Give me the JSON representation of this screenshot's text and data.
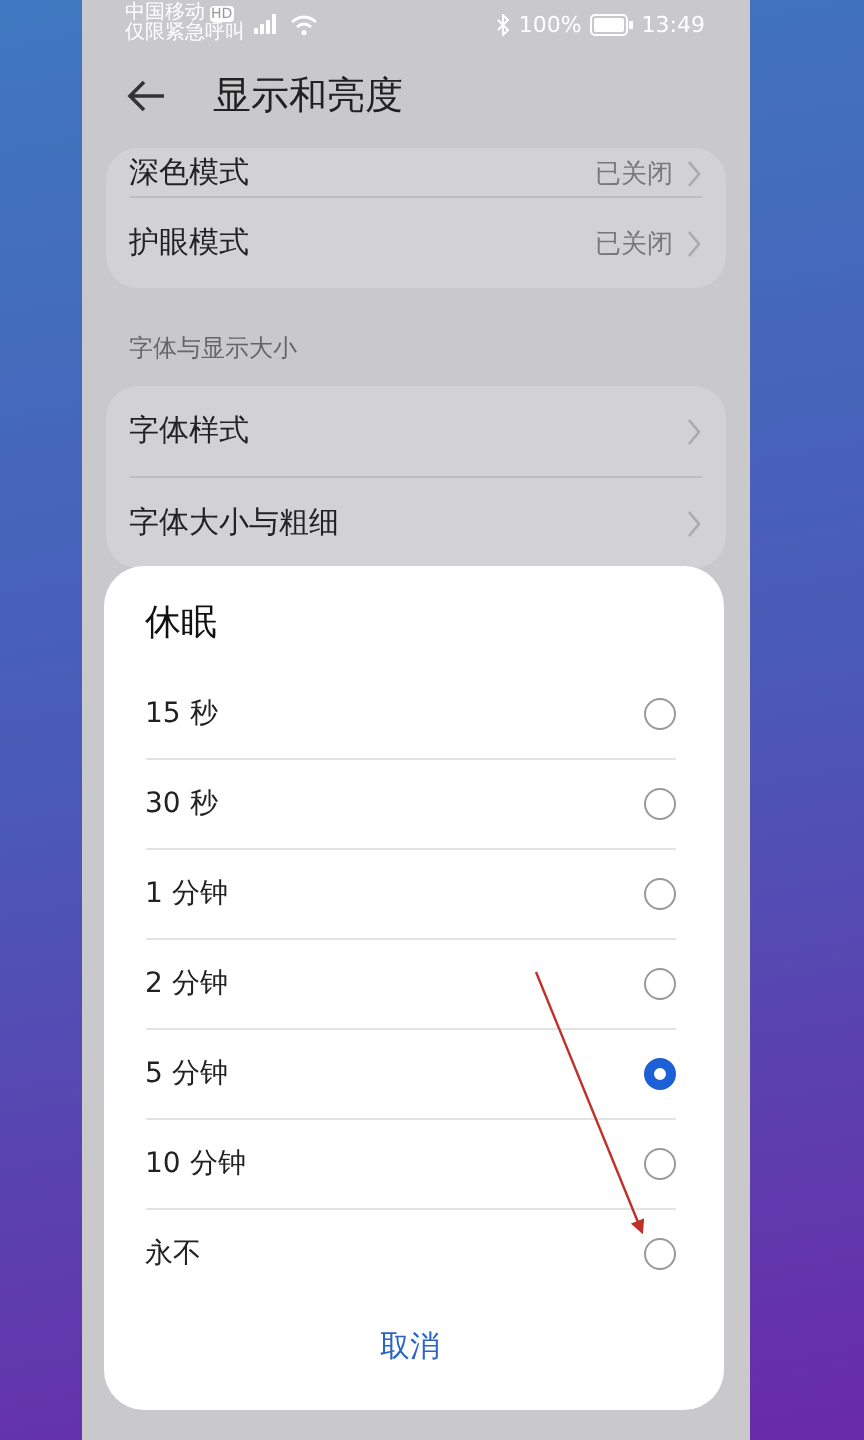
{
  "status_bar": {
    "carrier": "中国移动",
    "carrier_badge": "HD",
    "network_note": "仅限紧急呼叫",
    "battery": "100%",
    "time": "13:49"
  },
  "header": {
    "title": "显示和亮度"
  },
  "groups": [
    {
      "items": [
        {
          "label": "深色模式",
          "value": "已关闭"
        },
        {
          "label": "护眼模式",
          "value": "已关闭"
        }
      ]
    },
    {
      "heading": "字体与显示大小",
      "items": [
        {
          "label": "字体样式"
        },
        {
          "label": "字体大小与粗细"
        }
      ]
    }
  ],
  "dialog": {
    "title": "休眠",
    "options": [
      {
        "label": "15 秒",
        "selected": false
      },
      {
        "label": "30 秒",
        "selected": false
      },
      {
        "label": "1 分钟",
        "selected": false
      },
      {
        "label": "2 分钟",
        "selected": false
      },
      {
        "label": "5 分钟",
        "selected": true
      },
      {
        "label": "10 分钟",
        "selected": false
      },
      {
        "label": "永不",
        "selected": false
      }
    ],
    "cancel": "取消"
  }
}
